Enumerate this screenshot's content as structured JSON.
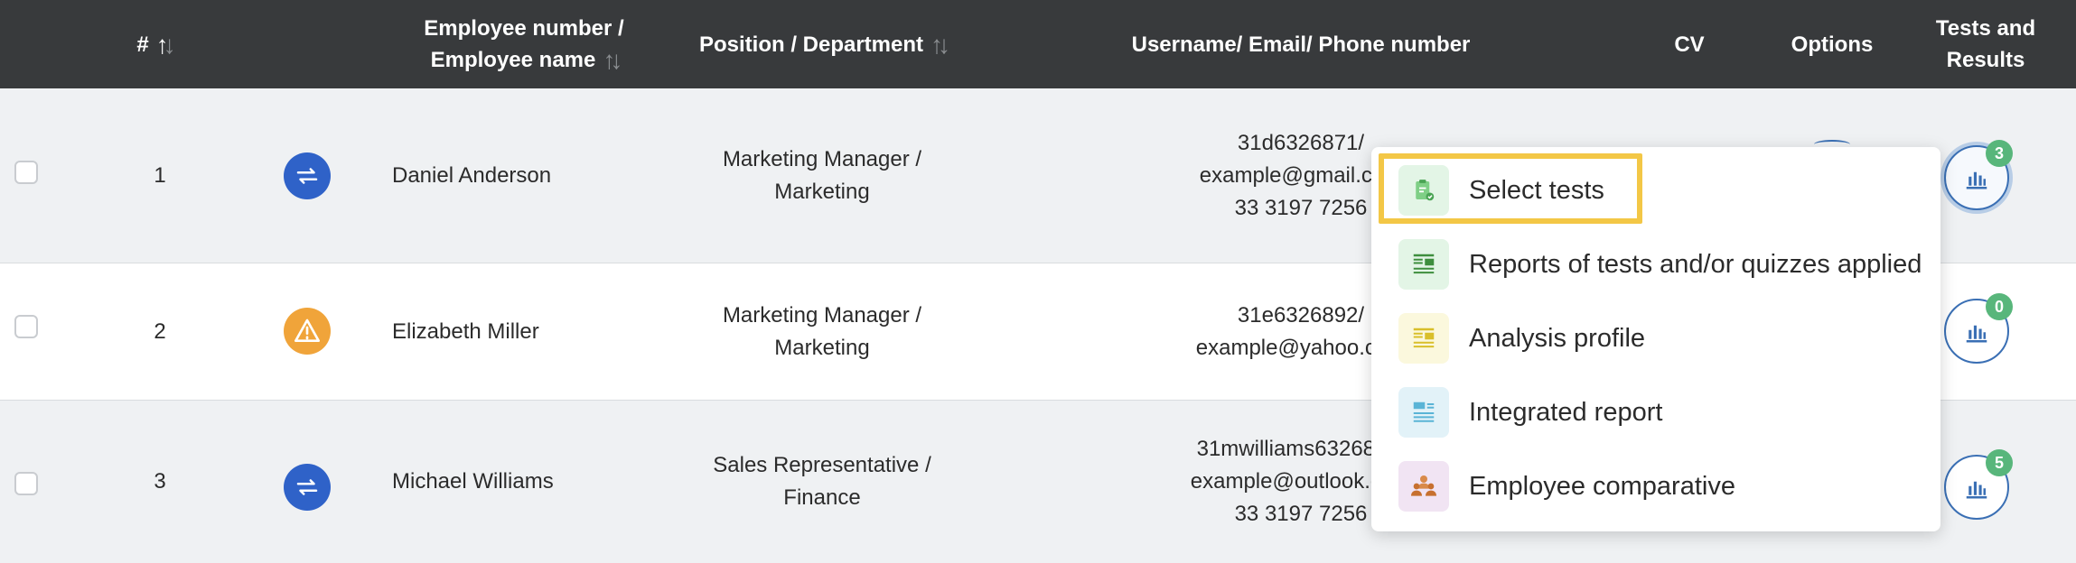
{
  "columns": {
    "num": "#",
    "employee_line1": "Employee number /",
    "employee_line2": "Employee name",
    "position": "Position / Department",
    "contact": "Username/ Email/ Phone number",
    "cv": "CV",
    "options": "Options",
    "tests_line1": "Tests and",
    "tests_line2": "Results"
  },
  "icons": {
    "sort": "sort-arrows-icon",
    "status_sync": "sync-icon",
    "status_warning": "warning-icon",
    "results": "bar-chart-icon"
  },
  "rows": [
    {
      "num": "1",
      "name": "Daniel Anderson",
      "position_line1": "Marketing Manager /",
      "position_line2": "Marketing",
      "contact_line1": "31d6326871/",
      "contact_line2": "example@gmail.com",
      "contact_line3": "33 3197 7256",
      "results_count": "3"
    },
    {
      "num": "2",
      "name": "Elizabeth Miller",
      "position_line1": "Marketing Manager /",
      "position_line2": "Marketing",
      "contact_line1": "31e6326892/",
      "contact_line2": "example@yahoo.com",
      "results_count": "0"
    },
    {
      "num": "3",
      "name": "Michael Williams",
      "position_line1": "Sales Representative /",
      "position_line2": "Finance",
      "contact_line1": "31mwilliams6326871/",
      "contact_line2": "example@outlook.com",
      "contact_line3": "33 3197 7256",
      "results_count": "5"
    }
  ],
  "menu": {
    "items": [
      {
        "label": "Select tests",
        "icon": "clipboard-check-icon",
        "color": "#5fbf6a",
        "bg": "#e3f5e6"
      },
      {
        "label": "Reports of tests and/or quizzes applied",
        "icon": "report-icon",
        "color": "#3e8e3e",
        "bg": "#e3f5e6"
      },
      {
        "label": "Analysis profile",
        "icon": "analysis-icon",
        "color": "#d9bf2a",
        "bg": "#fbf8dd"
      },
      {
        "label": "Integrated report",
        "icon": "integrated-report-icon",
        "color": "#5ab4d6",
        "bg": "#e2f2f8"
      },
      {
        "label": "Employee comparative",
        "icon": "employees-compare-icon",
        "color": "#d98a4a",
        "bg": "#f1e4f3"
      }
    ]
  },
  "colors": {
    "header_bg": "#383a3c",
    "accent_blue": "#2f62c8",
    "warning_orange": "#f0a43a",
    "badge_green": "#58b67b",
    "highlight_yellow": "#f3c746"
  }
}
